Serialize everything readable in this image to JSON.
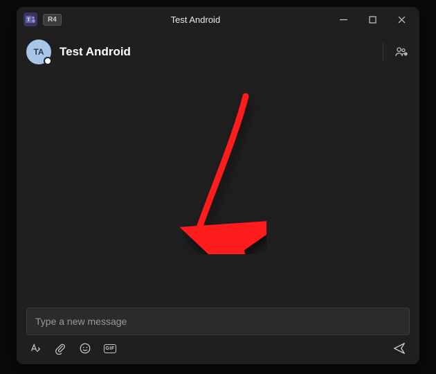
{
  "titlebar": {
    "app_badge": "T",
    "r_badge": "R4",
    "title": "Test Android"
  },
  "header": {
    "avatar_initials": "TA",
    "chat_name": "Test Android"
  },
  "compose": {
    "placeholder": "Type a new message",
    "gif_label": "GIF"
  }
}
